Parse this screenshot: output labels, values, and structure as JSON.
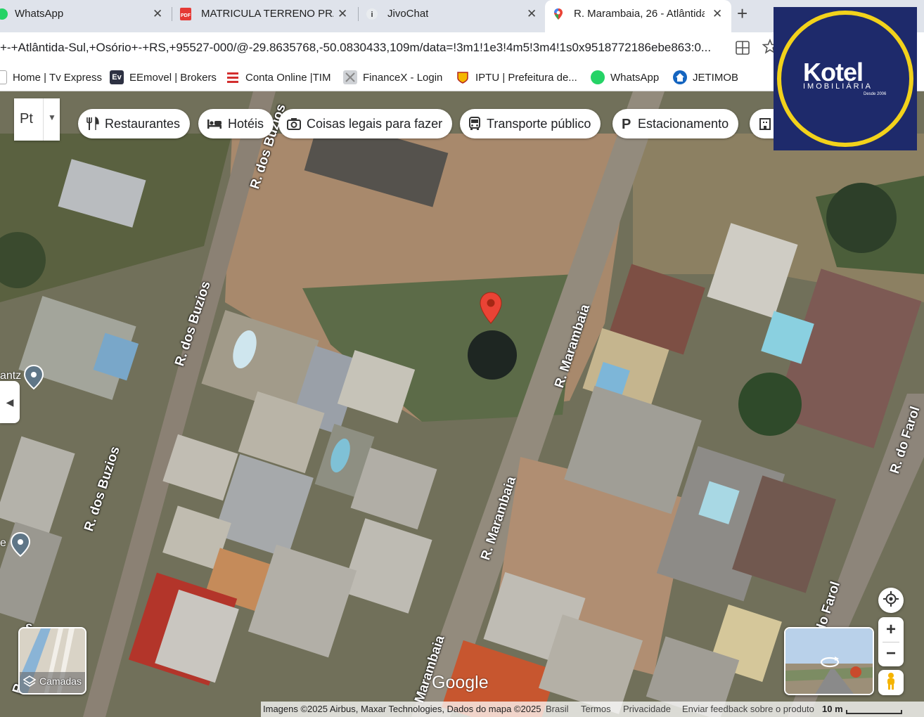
{
  "tabs": [
    {
      "title": "WhatsApp",
      "close": "✕"
    },
    {
      "title": "MATRICULA TERRENO PRAIA",
      "close": "✕"
    },
    {
      "title": "JivoChat",
      "close": "✕"
    },
    {
      "title": "R. Marambaia, 26 - Atlântida",
      "close": "✕"
    }
  ],
  "new_tab": "+",
  "address": {
    "url": "+-+Atlântida-Sul,+Osório+-+RS,+95527-000/@-29.8635768,-50.0830433,109m/data=!3m1!1e3!4m5!3m4!1s0x9518772186ebe863:0..."
  },
  "bookmarks": [
    {
      "label": "Home | Tv Express",
      "icon": "page-icon"
    },
    {
      "label": "EEmovel | Brokers",
      "icon": "eemovel-icon"
    },
    {
      "label": "Conta Online |TIM",
      "icon": "tim-icon"
    },
    {
      "label": "FinanceX - Login",
      "icon": "financex-icon"
    },
    {
      "label": "IPTU | Prefeitura de...",
      "icon": "prefeitura-icon"
    },
    {
      "label": "WhatsApp",
      "icon": "whatsapp-icon"
    },
    {
      "label": "JETIMOB",
      "icon": "jetimob-icon"
    }
  ],
  "map": {
    "type_button": "Pt",
    "chips": [
      {
        "label": "Restaurantes",
        "icon": "fork-knife-icon"
      },
      {
        "label": "Hotéis",
        "icon": "bed-icon"
      },
      {
        "label": "Coisas legais para fazer",
        "icon": "camera-icon"
      },
      {
        "label": "Transporte público",
        "icon": "bus-icon"
      },
      {
        "label": "Estacionamento",
        "icon": "parking-icon"
      }
    ],
    "streets": {
      "buzios_top": "R. dos Buzios",
      "buzios_mid": "R. dos Buzios",
      "buzios_low": "R. dos Buzios",
      "marambaia_top": "R. Marambaia",
      "marambaia_mid": "R. Marambaia",
      "marambaia_bottom": "Marambaia",
      "farol_right": "R. do Farol",
      "farol_bottom": "do Farol",
      "left_cut_s": "s",
      "left_cut_r": "R"
    },
    "poi_labels": [
      "antz",
      "e"
    ],
    "layers_label": "Camadas",
    "google": "Google",
    "attribution": {
      "imagery": "Imagens ©2025 Airbus, Maxar Technologies, Dados do mapa ©2025",
      "country": "Brasil",
      "terms": "Termos",
      "privacy": "Privacidade",
      "feedback": "Enviar feedback sobre o produto",
      "scale": "10 m"
    },
    "zoom_in": "+",
    "zoom_out": "−"
  },
  "kotel": {
    "name": "Kotel",
    "subtitle": "IMOBILIÁRIA",
    "since": "Desde 2006",
    "colors": {
      "bg": "#1e2a6b",
      "ring": "#f2d21b"
    }
  }
}
